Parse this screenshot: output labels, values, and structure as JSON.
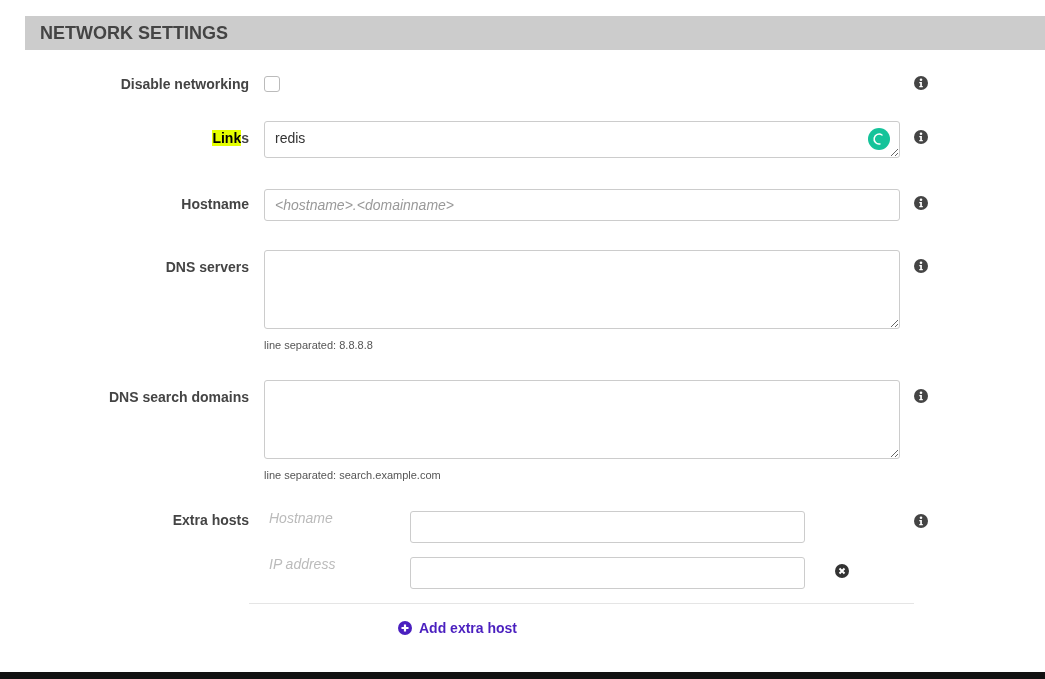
{
  "section": {
    "title": "NETWORK SETTINGS"
  },
  "fields": [
    {
      "kind": "checkbox",
      "label_parts": [
        {
          "text": "Disable networking",
          "highlighted": false
        }
      ],
      "checked": false
    },
    {
      "kind": "textarea",
      "label_parts": [
        {
          "text": "Link",
          "highlighted": true
        },
        {
          "text": "s",
          "highlighted": false
        }
      ],
      "value": "redis",
      "assistant": true
    },
    {
      "kind": "input",
      "label_parts": [
        {
          "text": "Hostname",
          "highlighted": false
        }
      ],
      "placeholder": "<hostname>.<domainname>"
    },
    {
      "kind": "textarea_tall",
      "label_parts": [
        {
          "text": "DNS servers",
          "highlighted": false
        }
      ],
      "hint": "line separated: 8.8.8.8"
    },
    {
      "kind": "textarea_tall",
      "label_parts": [
        {
          "text": "DNS search domains",
          "highlighted": false
        }
      ],
      "hint": "line separated: search.example.com"
    },
    {
      "kind": "pairs",
      "label_parts": [
        {
          "text": "Extra hosts",
          "highlighted": false
        }
      ],
      "subfields": [
        {
          "label": "Hostname"
        },
        {
          "label": "IP address"
        }
      ],
      "add_label": "Add extra host"
    }
  ]
}
